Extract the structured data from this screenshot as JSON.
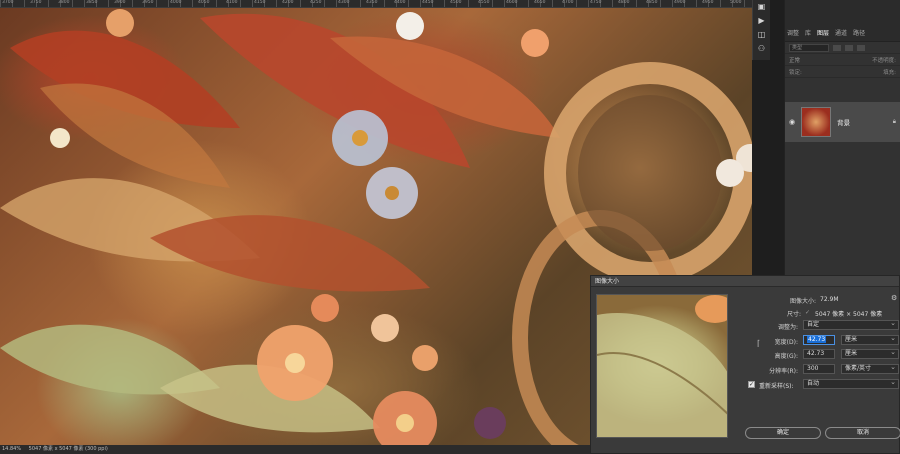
{
  "ruler": {
    "labels": [
      "3700",
      "3750",
      "3800",
      "3850",
      "3900",
      "3950",
      "4000",
      "4050",
      "4100",
      "4150",
      "4200",
      "4250",
      "4300",
      "4350",
      "4400",
      "4450",
      "4500",
      "4550",
      "4600",
      "4650",
      "4700",
      "4750",
      "4800",
      "4850",
      "4900",
      "4950",
      "5000"
    ]
  },
  "layers_panel": {
    "tabs": [
      "调整",
      "库",
      "图层",
      "通道",
      "路径"
    ],
    "active_tab": "图层",
    "search_placeholder": "类型",
    "row2_label": "正常",
    "row2_opacity_label": "不透明度:",
    "row3_label": "锁定:",
    "row3_fill_label": "填充:",
    "layer_name": "背景",
    "icons": [
      "eye-icon",
      "lock-icon"
    ]
  },
  "dialog": {
    "title": "图像大小",
    "image_size_label": "图像大小:",
    "image_size_value": "72.9M",
    "dimensions_label": "尺寸:",
    "dimensions_value": "5047 像素 × 5047 像素",
    "fit_label": "调整为:",
    "fit_value": "自定",
    "width_label": "宽度(D):",
    "width_value": "42.73",
    "width_unit": "厘米",
    "height_label": "高度(G):",
    "height_value": "42.73",
    "height_unit": "厘米",
    "resolution_label": "分辨率(R):",
    "resolution_value": "300",
    "resolution_unit": "像素/英寸",
    "resample_label": "重新采样(S):",
    "resample_checked": true,
    "resample_value": "自动",
    "ok_label": "确定",
    "cancel_label": "取消"
  },
  "status": {
    "zoom": "14.84%",
    "info": "5047 像素 x 5047 像素 (300 ppi)"
  }
}
